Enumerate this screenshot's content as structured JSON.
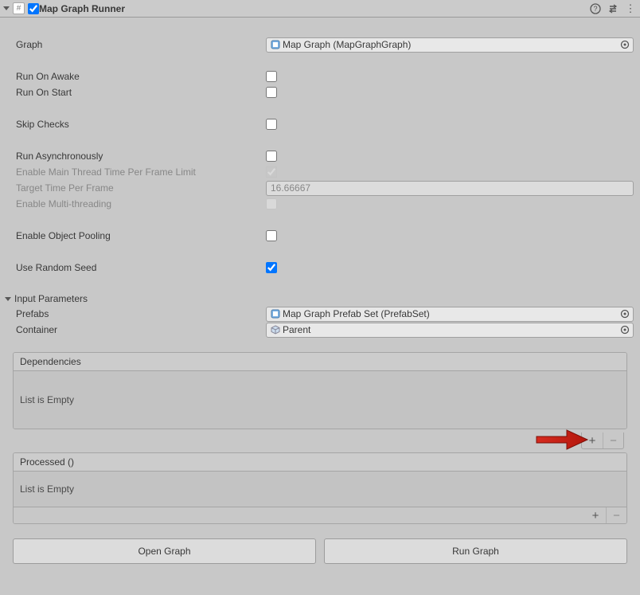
{
  "header": {
    "title": "Map Graph Runner",
    "enabled": true
  },
  "fields": {
    "graph_label": "Graph",
    "graph_value": "Map Graph (MapGraphGraph)",
    "run_on_awake_label": "Run On Awake",
    "run_on_awake": false,
    "run_on_start_label": "Run On Start",
    "run_on_start": false,
    "skip_checks_label": "Skip Checks",
    "skip_checks": false,
    "run_async_label": "Run Asynchronously",
    "run_async": false,
    "enable_main_thread_limit_label": "Enable Main Thread Time Per Frame Limit",
    "enable_main_thread_limit": true,
    "target_time_label": "Target Time Per Frame",
    "target_time_value": "16.66667",
    "enable_multithreading_label": "Enable Multi-threading",
    "enable_multithreading": false,
    "enable_pooling_label": "Enable Object Pooling",
    "enable_pooling": false,
    "use_random_seed_label": "Use Random Seed",
    "use_random_seed": true
  },
  "input_params": {
    "section_label": "Input Parameters",
    "prefabs_label": "Prefabs",
    "prefabs_value": "Map Graph Prefab Set (PrefabSet)",
    "container_label": "Container",
    "container_value": "Parent"
  },
  "lists": {
    "dependencies_label": "Dependencies",
    "dependencies_empty": "List is Empty",
    "processed_label": "Processed ()",
    "processed_empty": "List is Empty"
  },
  "buttons": {
    "open_graph": "Open Graph",
    "run_graph": "Run Graph"
  },
  "icons": {
    "help": "?",
    "preset": "⇄",
    "menu": "⋮",
    "plus": "+",
    "minus": "−"
  }
}
